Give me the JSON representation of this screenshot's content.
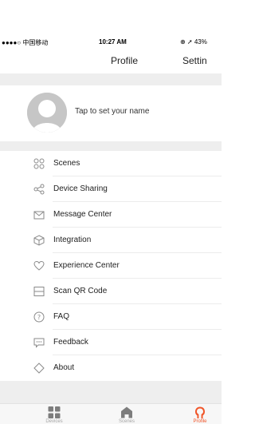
{
  "status_bar": {
    "carrier": "●●●●○ 中国移动",
    "time": "10:27 AM",
    "right": "⊕ ➚ 43%"
  },
  "nav": {
    "title": "Profile",
    "settings_label": "Settin"
  },
  "profile": {
    "prompt": "Tap to set your name"
  },
  "menu": [
    {
      "label": "Scenes",
      "icon": "scenes-icon"
    },
    {
      "label": "Device Sharing",
      "icon": "share-icon"
    },
    {
      "label": "Message Center",
      "icon": "envelope-icon"
    },
    {
      "label": "Integration",
      "icon": "cube-icon"
    },
    {
      "label": "Experience Center",
      "icon": "heart-icon"
    },
    {
      "label": "Scan QR Code",
      "icon": "scan-icon"
    },
    {
      "label": "FAQ",
      "icon": "question-icon"
    },
    {
      "label": "Feedback",
      "icon": "chat-icon"
    },
    {
      "label": "About",
      "icon": "diamond-icon"
    }
  ],
  "tabs": [
    {
      "label": "Devices",
      "active": false
    },
    {
      "label": "Scenes",
      "active": false
    },
    {
      "label": "Profile",
      "active": true
    }
  ],
  "colors": {
    "accent": "#f0562a",
    "separator": "#eeeeee",
    "icon": "#8a8a8a"
  }
}
